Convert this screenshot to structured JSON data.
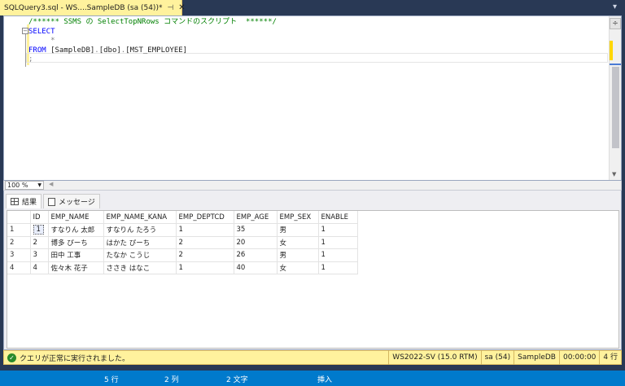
{
  "tab": {
    "title": "SQLQuery3.sql - WS....SampleDB (sa (54))*",
    "pin": "⊣",
    "close": "✕"
  },
  "editor": {
    "lines": [
      {
        "parts": [
          {
            "cls": "c-comment",
            "text": "/****** SSMS の SelectTopNRows コマンドのスクリプト  ******/"
          }
        ]
      },
      {
        "parts": [
          {
            "cls": "c-keyword",
            "text": "SELECT"
          }
        ]
      },
      {
        "parts": [
          {
            "cls": "c-punct",
            "text": "     *"
          }
        ]
      },
      {
        "parts": [
          {
            "cls": "c-keyword",
            "text": "FROM "
          },
          {
            "cls": "c-ident",
            "text": "[SampleDB]"
          },
          {
            "cls": "c-punct",
            "text": "."
          },
          {
            "cls": "c-ident",
            "text": "[dbo]"
          },
          {
            "cls": "c-punct",
            "text": "."
          },
          {
            "cls": "c-ident",
            "text": "[MST_EMPLOYEE]"
          }
        ]
      },
      {
        "parts": [
          {
            "cls": "c-punct",
            "text": ";"
          }
        ]
      }
    ]
  },
  "zoom": {
    "value": "100 %"
  },
  "results": {
    "tabs": [
      {
        "label": "結果"
      },
      {
        "label": "メッセージ"
      }
    ],
    "columns": [
      "",
      "ID",
      "EMP_NAME",
      "EMP_NAME_KANA",
      "EMP_DEPTCD",
      "EMP_AGE",
      "EMP_SEX",
      "ENABLE"
    ],
    "rows": [
      [
        "1",
        "1",
        "すなりん 太郎",
        "すなりん たろう",
        "1",
        "35",
        "男",
        "1"
      ],
      [
        "2",
        "2",
        "博多 ぴーち",
        "はかた ぴーち",
        "2",
        "20",
        "女",
        "1"
      ],
      [
        "3",
        "3",
        "田中 工事",
        "たなか こうじ",
        "2",
        "26",
        "男",
        "1"
      ],
      [
        "4",
        "4",
        "佐々木 花子",
        "ささき はなこ",
        "1",
        "40",
        "女",
        "1"
      ]
    ]
  },
  "status": {
    "message": "クエリが正常に実行されました。",
    "server": "WS2022-SV (15.0 RTM)",
    "user": "sa (54)",
    "database": "SampleDB",
    "time": "00:00:00",
    "rows": "4 行"
  },
  "idebar": {
    "line": "5 行",
    "col": "2 列",
    "chars": "2 文字",
    "mode": "挿入"
  }
}
